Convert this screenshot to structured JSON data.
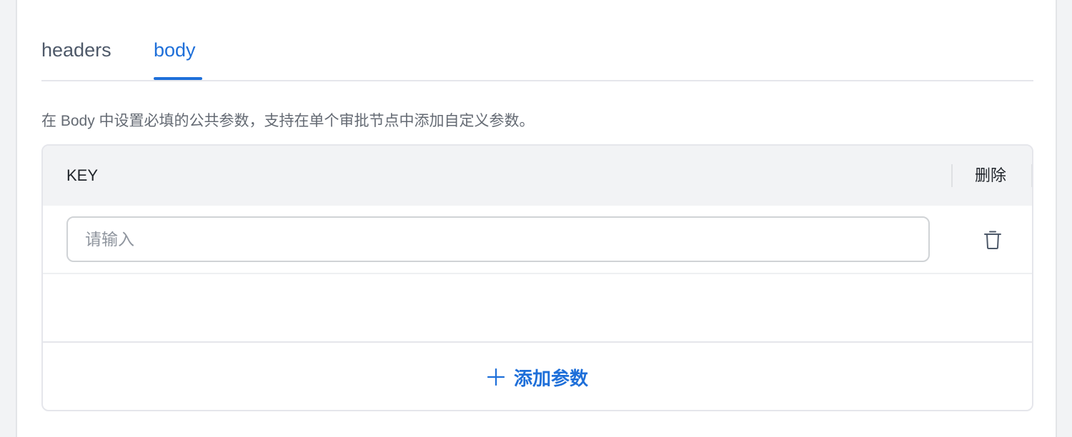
{
  "tabs": [
    {
      "label": "headers",
      "active": false
    },
    {
      "label": "body",
      "active": true
    }
  ],
  "description": "在 Body 中设置必填的公共参数，支持在单个审批节点中添加自定义参数。",
  "table": {
    "columns": {
      "key": "KEY",
      "delete": "删除"
    },
    "rows": [
      {
        "key_value": "",
        "key_placeholder": "请输入",
        "delete_icon": "trash-icon"
      }
    ]
  },
  "add_button": {
    "label": "添加参数",
    "icon": "plus-icon"
  },
  "colors": {
    "accent": "#1e6fd9",
    "header_bg": "#f2f3f5",
    "border": "#e5e6eb"
  }
}
